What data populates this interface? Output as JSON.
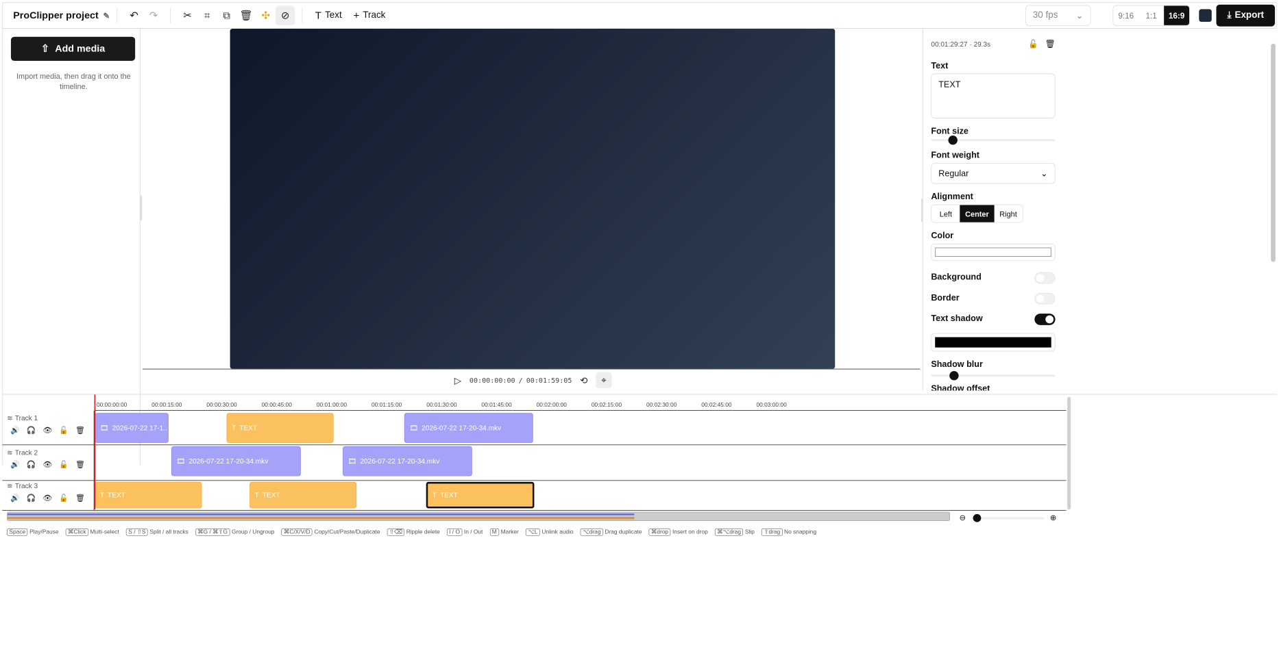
{
  "header": {
    "project_title": "ProClipper project",
    "text_btn": "Text",
    "track_btn": "Track",
    "fps": "30 fps",
    "aspect": [
      "9:16",
      "1:1",
      "16:9"
    ],
    "aspect_selected": "16:9",
    "export": "Export"
  },
  "left": {
    "add_media": "Add media",
    "hint": "Import media, then drag it onto the timeline."
  },
  "preview": {
    "current_time": "00:00:00:00",
    "separator": "/",
    "total_time": "00:01:59:05"
  },
  "inspector": {
    "timecode": "00:01:29:27 · 29.3s",
    "text_label": "Text",
    "text_value": "TEXT",
    "font_size_label": "Font size",
    "font_size_value": 0.15,
    "font_weight_label": "Font weight",
    "font_weight_value": "Regular",
    "alignment_label": "Alignment",
    "alignment": [
      "Left",
      "Center",
      "Right"
    ],
    "alignment_selected": "Center",
    "color_label": "Color",
    "background_label": "Background",
    "background_on": false,
    "border_label": "Border",
    "border_on": false,
    "text_shadow_label": "Text shadow",
    "text_shadow_on": true,
    "shadow_blur_label": "Shadow blur",
    "shadow_blur_value": 0.16,
    "shadow_offset_label": "Shadow offset"
  },
  "timeline": {
    "ticks": [
      "00:00:00:00",
      "00:00:15:00",
      "00:00:30:00",
      "00:00:45:00",
      "00:01:00:00",
      "00:01:15:00",
      "00:01:30:00",
      "00:01:45:00",
      "00:02:00:00",
      "00:02:15:00",
      "00:02:30:00",
      "00:02:45:00",
      "00:03:00:00"
    ],
    "tracks": [
      {
        "name": "Track 1",
        "clips": [
          {
            "type": "media",
            "label": "2026-07-22 17-1..."
          },
          {
            "type": "text",
            "label": "TEXT"
          },
          {
            "type": "media",
            "label": "2026-07-22 17-20-34.mkv"
          }
        ]
      },
      {
        "name": "Track 2",
        "clips": [
          {
            "type": "media",
            "label": "2026-07-22 17-20-34.mkv"
          },
          {
            "type": "media",
            "label": "2026-07-22 17-20-34.mkv"
          }
        ]
      },
      {
        "name": "Track 3",
        "clips": [
          {
            "type": "text",
            "label": "TEXT"
          },
          {
            "type": "text",
            "label": "TEXT"
          },
          {
            "type": "text",
            "label": "TEXT",
            "selected": true
          }
        ]
      }
    ],
    "shortcuts": [
      {
        "key": "Space",
        "label": "Play/Pause"
      },
      {
        "key": "⌘Click",
        "label": "Multi-select"
      },
      {
        "key": "S / ⇧S",
        "label": "Split / all tracks"
      },
      {
        "key": "⌘G / ⌘⇧G",
        "label": "Group / Ungroup"
      },
      {
        "key": "⌘C/X/V/D",
        "label": "Copy/Cut/Paste/Duplicate"
      },
      {
        "key": "⇧⌫",
        "label": "Ripple delete"
      },
      {
        "key": "I / O",
        "label": "In / Out"
      },
      {
        "key": "M",
        "label": "Marker"
      },
      {
        "key": "⌥L",
        "label": "Unlink audio"
      },
      {
        "key": "⌥drag",
        "label": "Drag duplicate"
      },
      {
        "key": "⌘drop",
        "label": "Insert on drop"
      },
      {
        "key": "⌘⌥drag",
        "label": "Slip"
      },
      {
        "key": "⇧drag",
        "label": "No snapping"
      }
    ]
  }
}
